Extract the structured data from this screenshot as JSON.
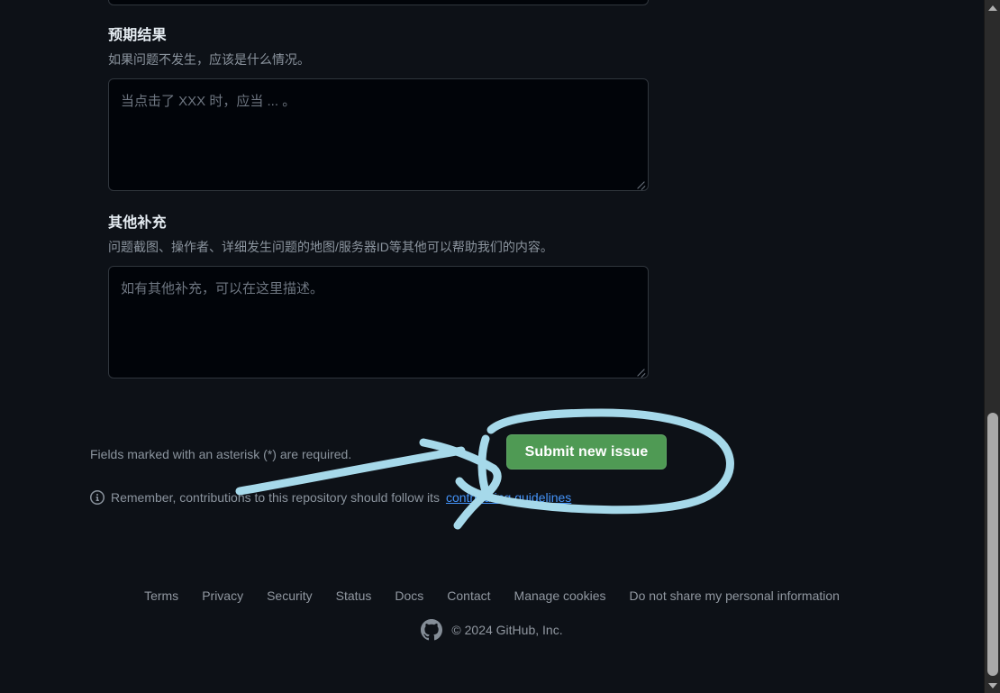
{
  "form": {
    "fields": [
      {
        "label": "预期结果",
        "description": "如果问题不发生，应该是什么情况。",
        "placeholder": "当点击了 XXX 时，应当 ... 。"
      },
      {
        "label": "其他补充",
        "description": "问题截图、操作者、详细发生问题的地图/服务器ID等其他可以帮助我们的内容。",
        "placeholder": "如有其他补充，可以在这里描述。"
      }
    ],
    "required_note": "Fields marked with an asterisk (*) are required.",
    "submit_label": "Submit new issue",
    "remember": {
      "prefix": "Remember, contributions to this repository should follow its ",
      "link_text": "contributing guidelines",
      "suffix": ""
    }
  },
  "footer": {
    "links": [
      "Terms",
      "Privacy",
      "Security",
      "Status",
      "Docs",
      "Contact",
      "Manage cookies",
      "Do not share my personal information"
    ],
    "copyright": "© 2024 GitHub, Inc."
  },
  "colors": {
    "page_background": "#0d1117",
    "input_background": "#010409",
    "border": "#30363d",
    "submit_green": "#4f9a54",
    "link_blue": "#4493f8",
    "muted_text": "#8b949e",
    "annotation_stroke": "#a6d9ea",
    "scrollbar_track": "#2b2b2b",
    "scrollbar_thumb": "#a9a9a9"
  },
  "annotation": {
    "type": "freehand-ink",
    "shape": "arrow-with-encircling-oval",
    "target": "Submit new issue"
  }
}
